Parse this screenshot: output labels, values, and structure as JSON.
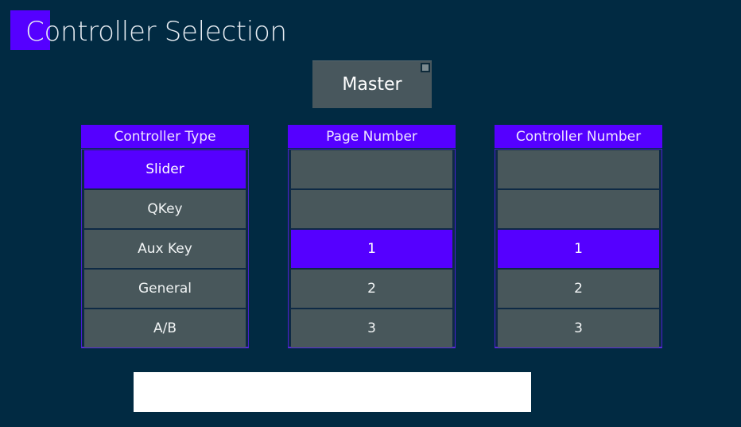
{
  "header": {
    "title": "Controller Selection"
  },
  "master_button": {
    "label": "Master"
  },
  "columns": {
    "controller_type": {
      "header": "Controller Type",
      "items": [
        {
          "label": "Slider",
          "selected": true
        },
        {
          "label": "QKey",
          "selected": false
        },
        {
          "label": "Aux Key",
          "selected": false
        },
        {
          "label": "General",
          "selected": false
        },
        {
          "label": "A/B",
          "selected": false
        }
      ]
    },
    "page_number": {
      "header": "Page Number",
      "items": [
        {
          "label": "",
          "selected": false
        },
        {
          "label": "",
          "selected": false
        },
        {
          "label": "1",
          "selected": true
        },
        {
          "label": "2",
          "selected": false
        },
        {
          "label": "3",
          "selected": false
        }
      ]
    },
    "controller_number": {
      "header": "Controller Number",
      "items": [
        {
          "label": "",
          "selected": false
        },
        {
          "label": "",
          "selected": false
        },
        {
          "label": "1",
          "selected": true
        },
        {
          "label": "2",
          "selected": false
        },
        {
          "label": "3",
          "selected": false
        }
      ]
    }
  },
  "text_box": {
    "value": "",
    "placeholder": ""
  },
  "colors": {
    "background": "#012a42",
    "accent": "#5500ff",
    "item": "#48575b",
    "text_box": "#ffffff"
  }
}
